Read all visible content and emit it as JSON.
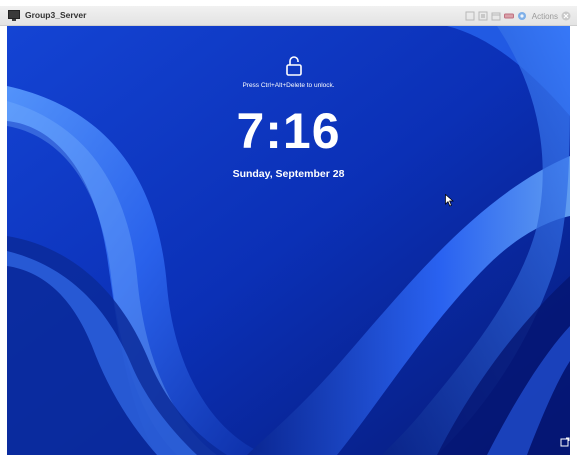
{
  "window": {
    "title": "Group3_Server"
  },
  "toolbar": {
    "icons": [
      "fit-window-icon",
      "fullscreen-icon",
      "restore-icon",
      "keyboard-icon",
      "gear-icon",
      "close-icon"
    ],
    "actions_label": "Actions"
  },
  "lockscreen": {
    "unlock_hint": "Press Ctrl+Alt+Delete to unlock.",
    "time": "7:16",
    "date": "Sunday, September 28"
  },
  "colors": {
    "wallpaper_base": "#0b2fb8",
    "wallpaper_highlight": "#3d7bff",
    "text": "#ffffff"
  }
}
